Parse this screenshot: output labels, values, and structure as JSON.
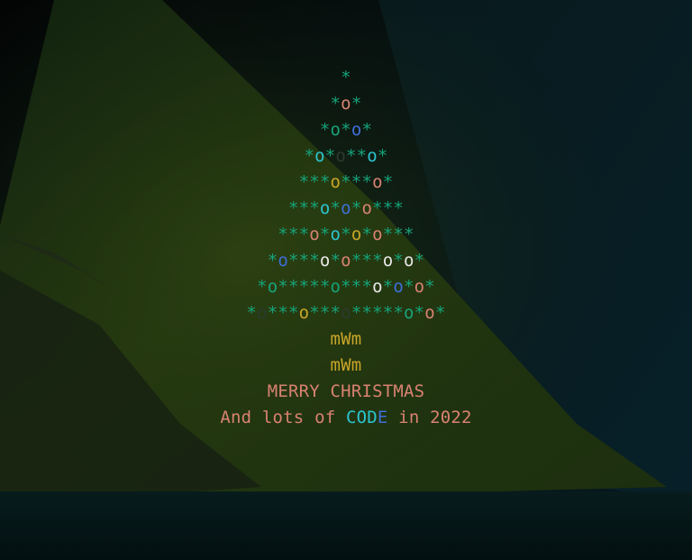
{
  "tree": {
    "rows": [
      [
        [
          "g",
          "*"
        ]
      ],
      [
        [
          "g",
          "*"
        ],
        [
          "rd",
          "o"
        ],
        [
          "g",
          "*"
        ]
      ],
      [
        [
          "g",
          "*"
        ],
        [
          "g",
          "o"
        ],
        [
          "g",
          "*"
        ],
        [
          "bl",
          "o"
        ],
        [
          "g",
          "*"
        ]
      ],
      [
        [
          "g",
          "*"
        ],
        [
          "cy",
          "o"
        ],
        [
          "g",
          "*"
        ],
        [
          "dk",
          "o"
        ],
        [
          "g",
          "*"
        ],
        [
          "g",
          "*"
        ],
        [
          "cy",
          "o"
        ],
        [
          "g",
          "*"
        ]
      ],
      [
        [
          "g",
          "***"
        ],
        [
          "gd",
          "o"
        ],
        [
          "g",
          "***"
        ],
        [
          "rd",
          "o"
        ],
        [
          "g",
          "*"
        ]
      ],
      [
        [
          "g",
          "***"
        ],
        [
          "cy",
          "o"
        ],
        [
          "g",
          "*"
        ],
        [
          "bl",
          "o"
        ],
        [
          "g",
          "*"
        ],
        [
          "rd",
          "o"
        ],
        [
          "g",
          "***"
        ]
      ],
      [
        [
          "g",
          "***"
        ],
        [
          "rd",
          "o"
        ],
        [
          "g",
          "*"
        ],
        [
          "cy",
          "o"
        ],
        [
          "g",
          "*"
        ],
        [
          "gd",
          "o"
        ],
        [
          "g",
          "*"
        ],
        [
          "rd",
          "o"
        ],
        [
          "g",
          "***"
        ]
      ],
      [
        [
          "g",
          "*"
        ],
        [
          "bl",
          "o"
        ],
        [
          "g",
          "***"
        ],
        [
          "wh",
          "o"
        ],
        [
          "g",
          "*"
        ],
        [
          "rd",
          "o"
        ],
        [
          "g",
          "***"
        ],
        [
          "wh",
          "o"
        ],
        [
          "g",
          "*"
        ],
        [
          "wh",
          "o"
        ],
        [
          "g",
          "*"
        ]
      ],
      [
        [
          "g",
          "*"
        ],
        [
          "g",
          "o"
        ],
        [
          "g",
          "*****"
        ],
        [
          "g",
          "o"
        ],
        [
          "g",
          "***"
        ],
        [
          "wh",
          "o"
        ],
        [
          "g",
          "*"
        ],
        [
          "bl",
          "o"
        ],
        [
          "g",
          "*"
        ],
        [
          "rd",
          "o"
        ],
        [
          "g",
          "*"
        ]
      ],
      [
        [
          "g",
          "*"
        ],
        [
          "dk",
          "o"
        ],
        [
          "g",
          "***"
        ],
        [
          "gd",
          "o"
        ],
        [
          "g",
          "***"
        ],
        [
          "dk",
          "o"
        ],
        [
          "g",
          "*****"
        ],
        [
          "g",
          "o"
        ],
        [
          "g",
          "*"
        ],
        [
          "rd",
          "o"
        ],
        [
          "g",
          "*"
        ]
      ]
    ],
    "trunk": [
      "mWm",
      "mWm"
    ]
  },
  "greeting": {
    "line1": "MERRY CHRISTMAS",
    "line2_prefix": "And lots of ",
    "line2_code_a": "COD",
    "line2_code_b": "E",
    "line2_suffix": " in 2022"
  }
}
